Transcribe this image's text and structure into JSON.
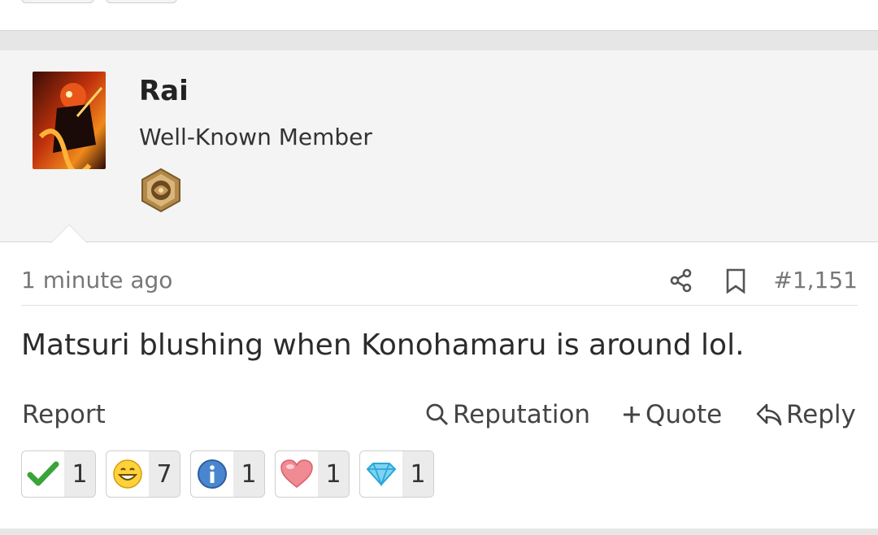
{
  "user": {
    "name": "Rai",
    "title": "Well-Known Member"
  },
  "post": {
    "timestamp": "1 minute ago",
    "number": "#1,151",
    "message": "Matsuri blushing when Konohamaru is around lol."
  },
  "actions": {
    "report": "Report",
    "reputation": "Reputation",
    "quote": "Quote",
    "reply": "Reply"
  },
  "reactions": [
    {
      "icon": "checkmark-icon",
      "count": "1"
    },
    {
      "icon": "grin-icon",
      "count": "7"
    },
    {
      "icon": "info-icon",
      "count": "1"
    },
    {
      "icon": "heart-icon",
      "count": "1"
    },
    {
      "icon": "diamond-icon",
      "count": "1"
    }
  ],
  "colors": {
    "user_block_bg": "#f4f4f4",
    "meta_text": "#777777",
    "count_bg": "#ebebeb"
  }
}
